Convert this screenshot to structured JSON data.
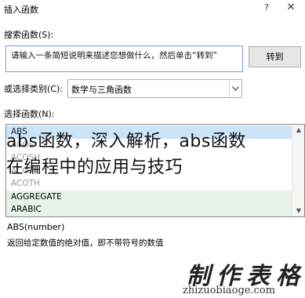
{
  "dialog": {
    "title": "插入函数",
    "help_symbol": "?",
    "close_symbol": "✕"
  },
  "search": {
    "label": "搜索函数(S):",
    "value": "请输入一条简短说明来描述您想做什么，然后单击“转到”",
    "goto_label": "转到"
  },
  "category": {
    "label": "或选择类别(C):",
    "selected": "数学与三角函数"
  },
  "functions": {
    "label": "选择函数(N):",
    "items": [
      "ABS",
      "ACOS",
      "ACOSH",
      "ACOT",
      "ACOTH",
      "AGGREGATE",
      "ARABIC"
    ]
  },
  "overlay": {
    "line1": "abs函数，深入解析，abs函数",
    "line2": "在编程中的应用与技巧"
  },
  "details": {
    "syntax": "ABS(number)",
    "description": "返回给定数值的绝对值，即不带符号的数值"
  },
  "watermark": {
    "chinese": "制作表格",
    "url": "zhizuobiaoge.com"
  },
  "icons": {
    "dropdown": "chevron-down-icon",
    "scroll_up": "scroll-up-arrow-icon",
    "scroll_down": "scroll-down-arrow-icon"
  }
}
